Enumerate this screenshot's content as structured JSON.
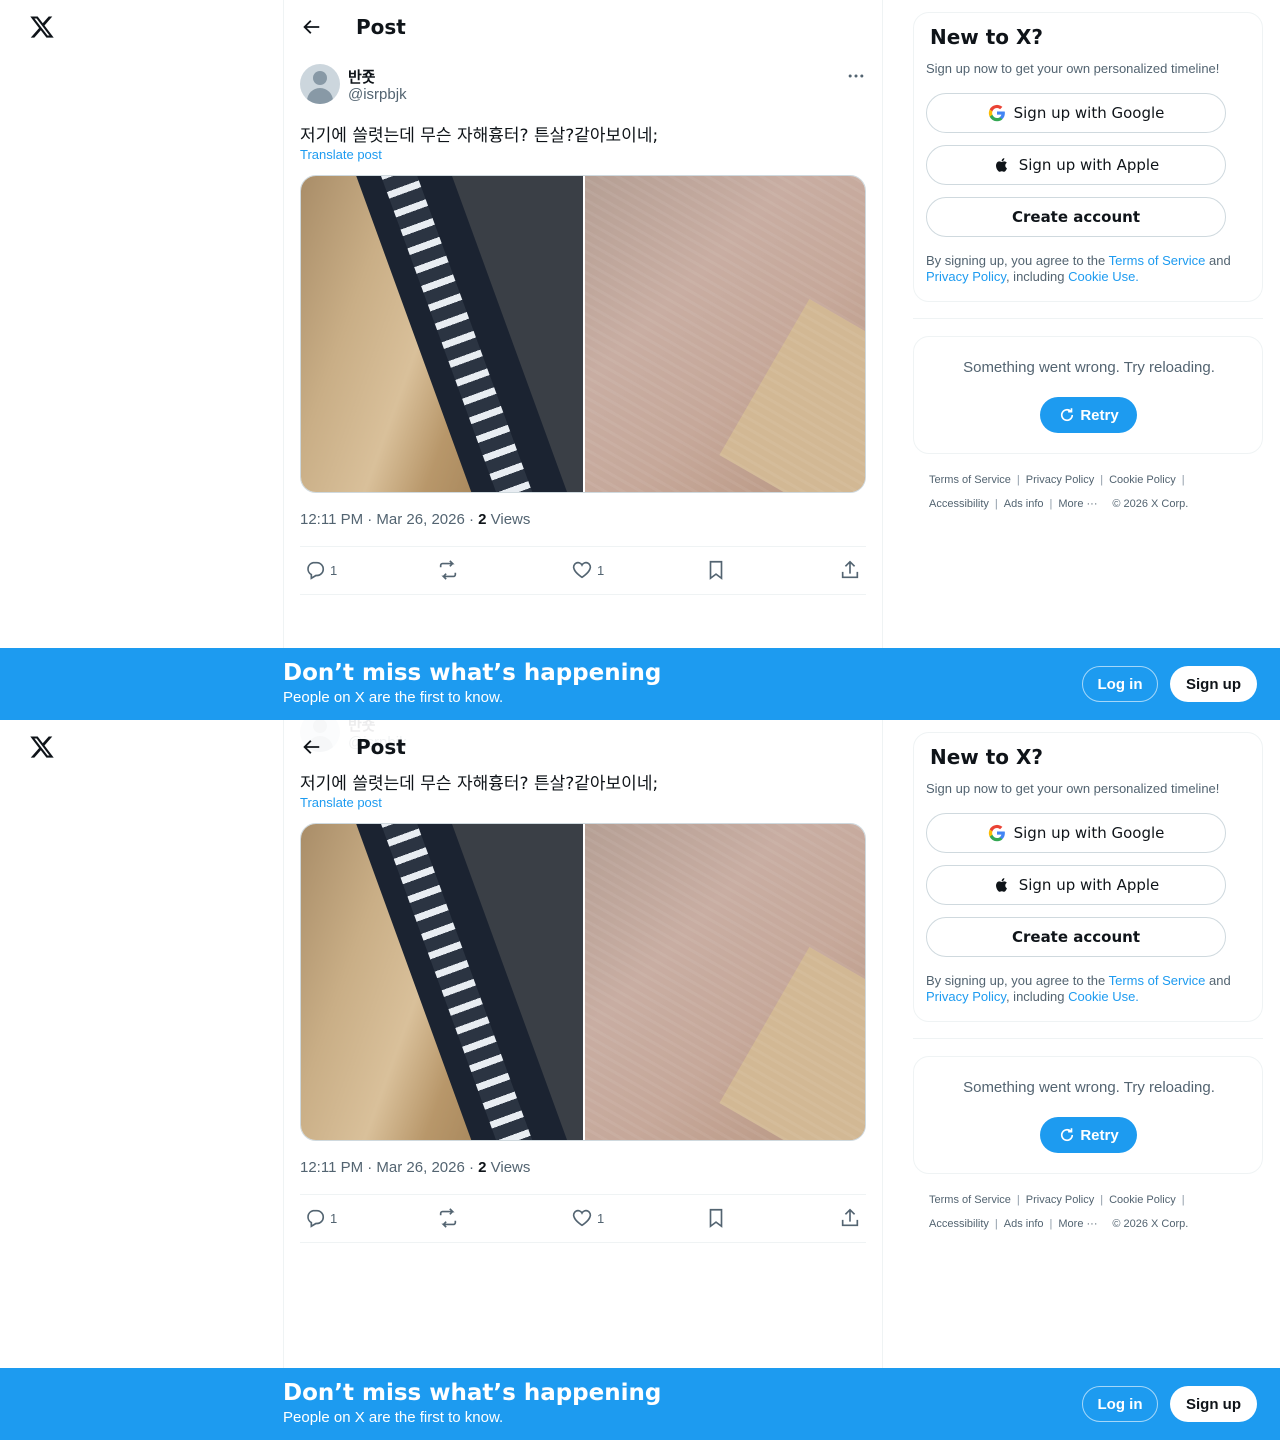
{
  "header": {
    "title": "Post"
  },
  "post": {
    "display_name": "반죳",
    "handle": "@isrpbjk",
    "text": "저기에 쓸렷는데 무슨 자해흉터? 튼살?같아보이네;",
    "translate_label": "Translate post",
    "timestamp": "12:11 PM · Mar 26, 2026 · ",
    "views_count": "2",
    "views_label": " Views",
    "replies": "1",
    "likes": "1"
  },
  "sidebar": {
    "signup_title": "New to X?",
    "signup_subtitle": "Sign up now to get your own personalized timeline!",
    "google_label": "Sign up with Google",
    "apple_label": "Sign up with Apple",
    "create_label": "Create account",
    "legal_prefix": "By signing up, you agree to the ",
    "terms_link": "Terms of Service",
    "legal_and": " and ",
    "privacy_link": "Privacy Policy",
    "legal_including": ", including ",
    "cookie_link": "Cookie Use.",
    "error_text": "Something went wrong. Try reloading.",
    "retry_label": "Retry"
  },
  "footer": {
    "terms": "Terms of Service",
    "privacy": "Privacy Policy",
    "cookie": "Cookie Policy",
    "accessibility": "Accessibility",
    "ads": "Ads info",
    "more": "More ···",
    "copyright": "© 2026 X Corp."
  },
  "banner": {
    "title": "Don’t miss what’s happening",
    "subtitle": "People on X are the first to know.",
    "login_label": "Log in",
    "signup_label": "Sign up"
  },
  "colors": {
    "accent": "#1d9bf0",
    "text": "#0f1419",
    "muted": "#536471",
    "border": "#eff3f4"
  },
  "icons": [
    "x-logo-icon",
    "back-arrow-icon",
    "more-icon",
    "reply-icon",
    "repost-icon",
    "like-icon",
    "bookmark-icon",
    "share-icon",
    "google-icon",
    "apple-icon",
    "refresh-icon"
  ]
}
